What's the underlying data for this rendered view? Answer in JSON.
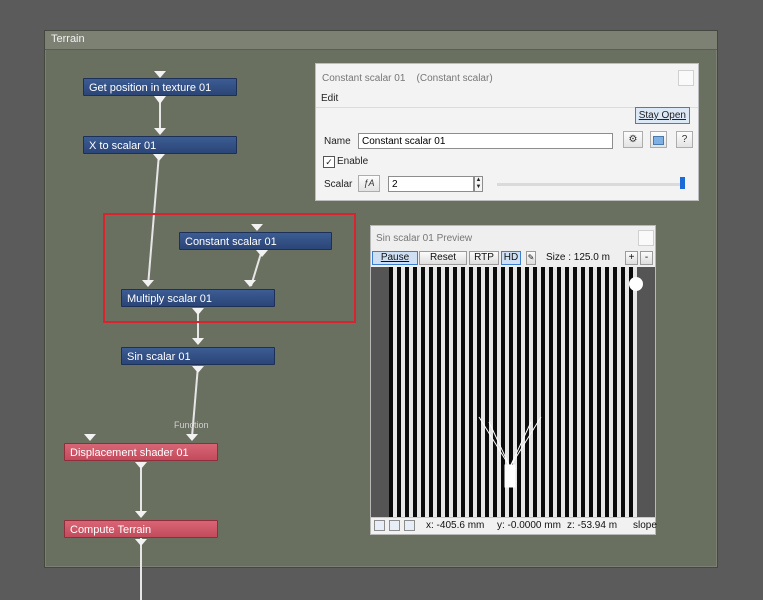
{
  "graph": {
    "title": "Terrain",
    "nodes": {
      "get_position": "Get position in texture 01",
      "x_to_scalar": "X to scalar 01",
      "constant_scalar": "Constant scalar 01",
      "multiply_scalar": "Multiply scalar 01",
      "sin_scalar": "Sin scalar 01",
      "displacement": "Displacement shader 01",
      "compute_terrain": "Compute Terrain"
    },
    "function_label": "Function",
    "colors": {
      "function_node": "#2f4c80",
      "shader_node": "#cf5667",
      "highlight": "#d9232d"
    }
  },
  "properties": {
    "title": "Constant scalar 01",
    "type": "(Constant scalar)",
    "menu_edit": "Edit",
    "stay_open": "Stay Open",
    "name_label": "Name",
    "name_value": "Constant scalar 01",
    "help": "?",
    "enable_label": "Enable",
    "enable_checked": true,
    "scalar_label": "Scalar",
    "scalar_value": "2"
  },
  "preview": {
    "title": "Sin scalar 01 Preview",
    "pause": "Pause",
    "reset": "Reset",
    "rtp": "RTP",
    "hd": "HD",
    "size": "Size : 125.0 m",
    "plus": "+",
    "minus": "-",
    "status": {
      "x": "x: -405.6 mm",
      "y": "y: -0.0000 mm",
      "z": "z: -53.94 m",
      "slope": "slope"
    }
  }
}
